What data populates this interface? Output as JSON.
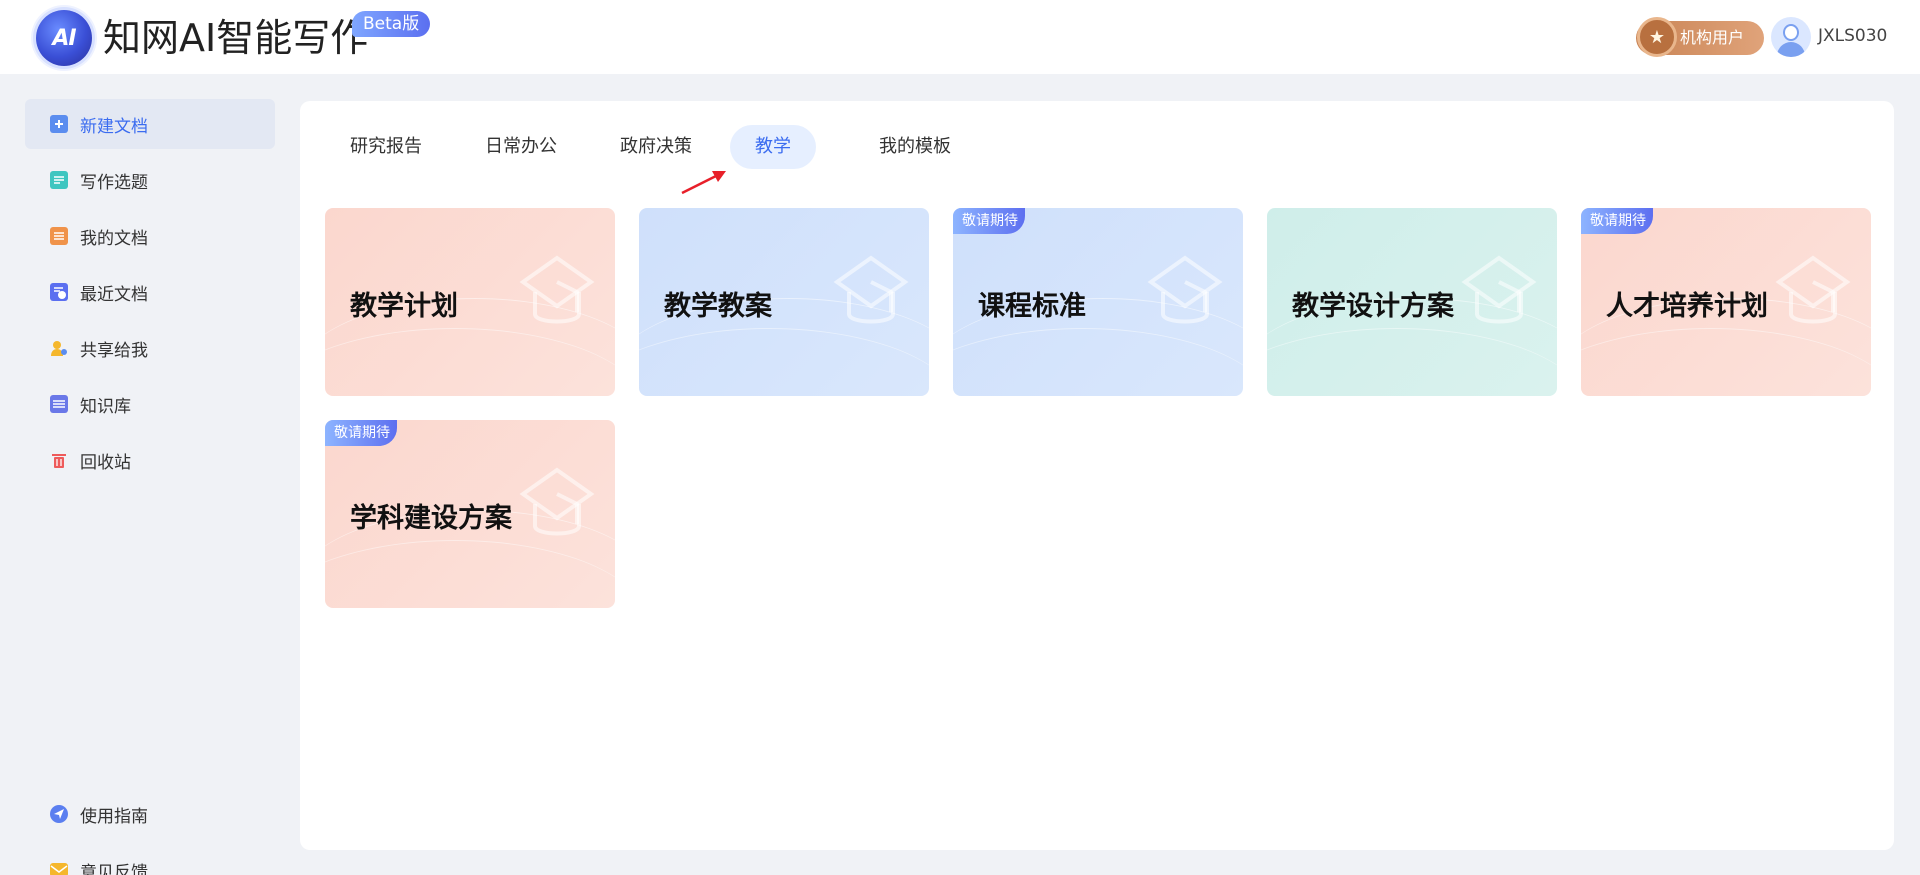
{
  "header": {
    "logo_text": "AI",
    "title": "知网AI智能写作",
    "beta": "Beta版",
    "org_label": "机构用户",
    "username": "JXLS030"
  },
  "sidebar": {
    "items": [
      {
        "label": "新建文档",
        "icon": "new-doc-icon",
        "color": "#5b8def"
      },
      {
        "label": "写作选题",
        "icon": "topic-icon",
        "color": "#3ec6c0"
      },
      {
        "label": "我的文档",
        "icon": "my-doc-icon",
        "color": "#f0934a"
      },
      {
        "label": "最近文档",
        "icon": "recent-doc-icon",
        "color": "#5b6ff0"
      },
      {
        "label": "共享给我",
        "icon": "share-icon",
        "color": "#f5b72c"
      },
      {
        "label": "知识库",
        "icon": "knowledge-icon",
        "color": "#6a78e8"
      },
      {
        "label": "回收站",
        "icon": "trash-icon",
        "color": "#ee5b5b"
      }
    ],
    "bottom": [
      {
        "label": "使用指南",
        "icon": "guide-icon",
        "color": "#5b7ff0"
      },
      {
        "label": "意见反馈",
        "icon": "mail-icon",
        "color": "#f5b72c"
      }
    ]
  },
  "tabs": [
    "研究报告",
    "日常办公",
    "政府决策",
    "教学",
    "我的模板"
  ],
  "active_tab": "教学",
  "cards": [
    {
      "title": "教学计划",
      "tag": "",
      "color": "pink"
    },
    {
      "title": "教学教案",
      "tag": "",
      "color": "blue"
    },
    {
      "title": "课程标准",
      "tag": "敬请期待",
      "color": "blue"
    },
    {
      "title": "教学设计方案",
      "tag": "",
      "color": "teal"
    },
    {
      "title": "人才培养计划",
      "tag": "敬请期待",
      "color": "pink"
    },
    {
      "title": "学科建设方案",
      "tag": "敬请期待",
      "color": "pink"
    }
  ],
  "colors": {
    "accent": "#3b6cf0",
    "arrow": "#e8202a"
  }
}
